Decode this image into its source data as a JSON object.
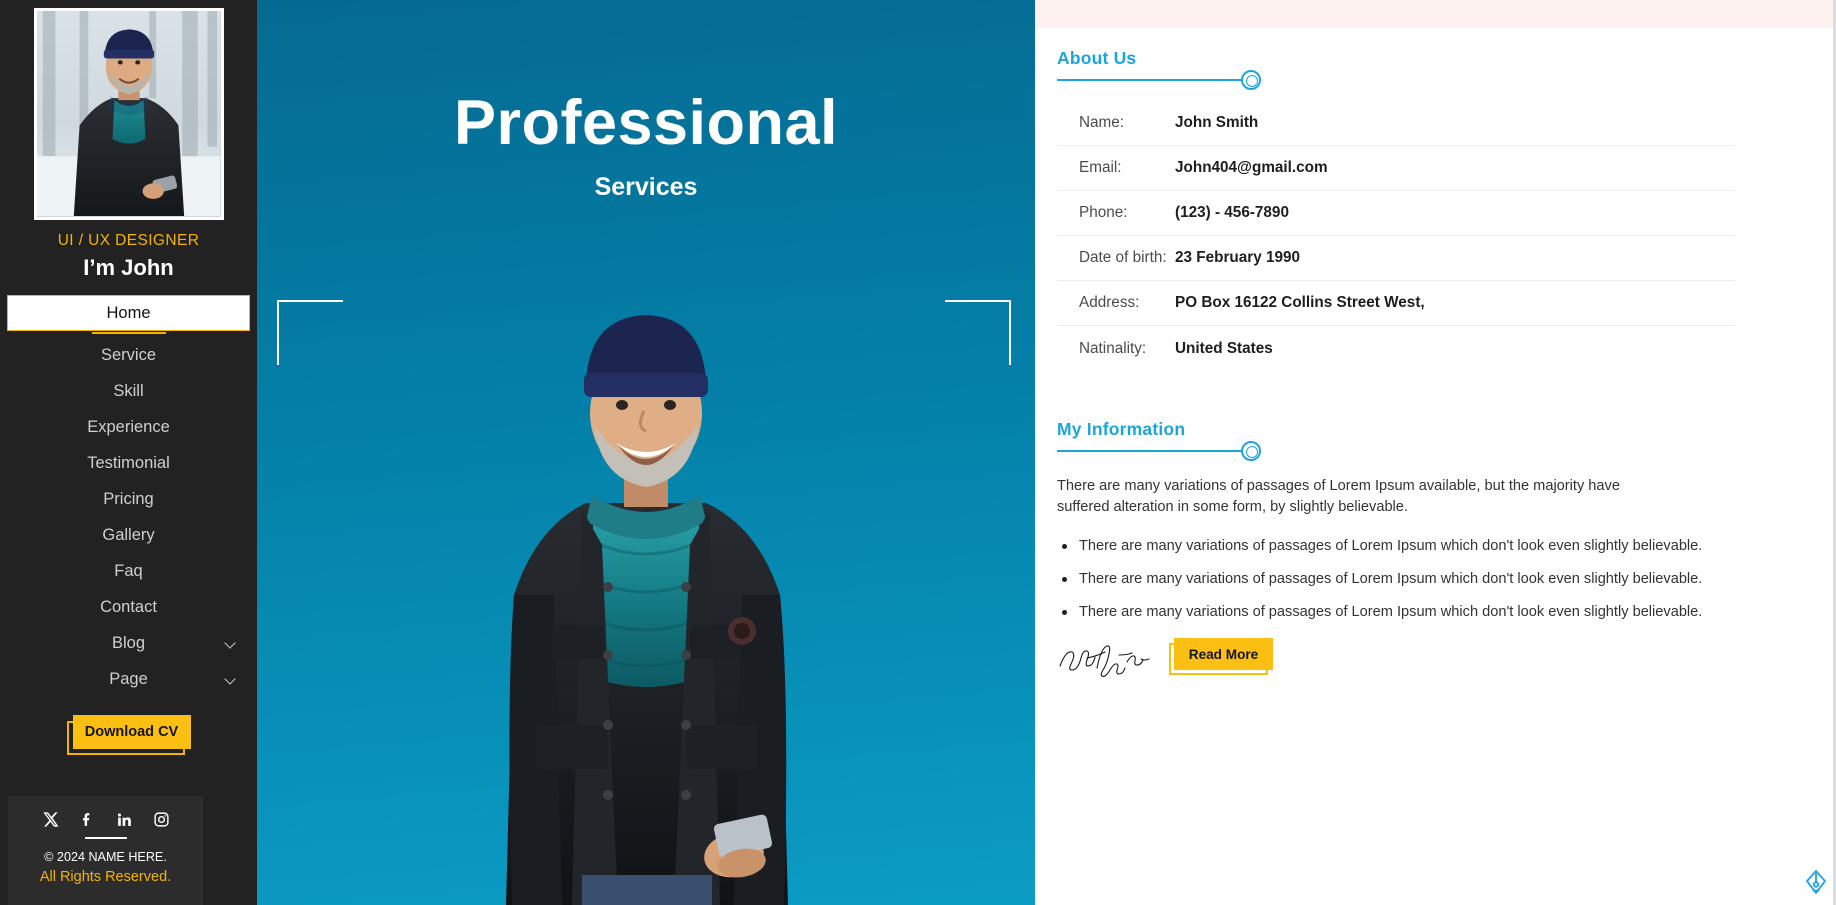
{
  "sidebar": {
    "avatar_alt": "profile-photo",
    "role": "UI / UX DESIGNER",
    "name": "I’m John",
    "nav": [
      {
        "label": "Home",
        "active": true,
        "chevron": false
      },
      {
        "label": "Service",
        "active": false,
        "chevron": false
      },
      {
        "label": "Skill",
        "active": false,
        "chevron": false
      },
      {
        "label": "Experience",
        "active": false,
        "chevron": false
      },
      {
        "label": "Testimonial",
        "active": false,
        "chevron": false
      },
      {
        "label": "Pricing",
        "active": false,
        "chevron": false
      },
      {
        "label": "Gallery",
        "active": false,
        "chevron": false
      },
      {
        "label": "Faq",
        "active": false,
        "chevron": false
      },
      {
        "label": "Contact",
        "active": false,
        "chevron": false
      },
      {
        "label": "Blog",
        "active": false,
        "chevron": true
      },
      {
        "label": "Page",
        "active": false,
        "chevron": true
      }
    ],
    "download_cv_label": "Download CV",
    "socials": [
      {
        "name": "twitter-x-icon",
        "label": "X"
      },
      {
        "name": "facebook-icon",
        "label": "f"
      },
      {
        "name": "linkedin-icon",
        "label": "in"
      },
      {
        "name": "instagram-icon",
        "label": "ig"
      }
    ],
    "copyright_line1": "© 2024 NAME HERE.",
    "copyright_line2": "All Rights Reserved."
  },
  "hero": {
    "title": "Professional",
    "subtitle": "Services"
  },
  "about": {
    "section_title": "About Us",
    "rows": [
      {
        "label": "Name:",
        "value": "John Smith"
      },
      {
        "label": "Email:",
        "value": "John404@gmail.com"
      },
      {
        "label": "Phone:",
        "value": "(123) - 456-7890"
      },
      {
        "label": "Date of birth:",
        "value": "23 February 1990"
      },
      {
        "label": "Address:",
        "value": "PO Box 16122 Collins Street West,"
      },
      {
        "label": "Natinality:",
        "value": "United States"
      }
    ]
  },
  "my_information": {
    "section_title": "My Information",
    "paragraph": "There are many variations of passages of Lorem Ipsum available, but the majority have suffered alteration in some form, by slightly believable.",
    "bullets": [
      "There are many variations of passages of Lorem Ipsum which don't look even slightly believable.",
      "There are many variations of passages of Lorem Ipsum which don't look even slightly believable.",
      "There are many variations of passages of Lorem Ipsum which don't look even slightly believable."
    ],
    "signature_text": "Frank Sinatra",
    "read_more_label": "Read More"
  },
  "widgets": {
    "nib_tool_name": "pen-nib-icon"
  },
  "colors": {
    "sidebar_bg": "#222222",
    "accent_yellow": "#fbbf14",
    "accent_blue": "#1ca5dc",
    "hero_blue_dark": "#056a92",
    "hero_blue_light": "#0b9cc4"
  }
}
